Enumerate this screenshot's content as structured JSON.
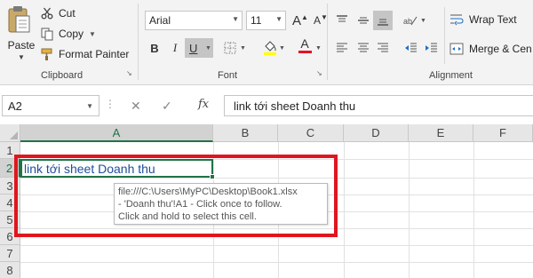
{
  "clipboard": {
    "paste_label": "Paste",
    "cut_label": "Cut",
    "copy_label": "Copy",
    "format_painter_label": "Format Painter",
    "group_label": "Clipboard"
  },
  "font": {
    "name": "Arial",
    "size": "11",
    "group_label": "Font",
    "bold_label": "B",
    "italic_label": "I",
    "underline_label": "U",
    "font_color_label": "A",
    "grow_label": "A",
    "shrink_label": "A",
    "font_color_bar": "#e81123",
    "fill_color_bar": "#ffff00"
  },
  "alignment": {
    "wrap_text_label": "Wrap Text",
    "merge_label": "Merge & Cen",
    "group_label": "Alignment"
  },
  "formula_bar": {
    "name_box": "A2",
    "cancel_label": "✕",
    "enter_label": "✓",
    "fx_label": "fx",
    "content": "link tới sheet Doanh thu"
  },
  "grid": {
    "columns": [
      "A",
      "B",
      "C",
      "D",
      "E",
      "F"
    ],
    "rows": [
      "1",
      "2",
      "3",
      "4",
      "5",
      "6",
      "7",
      "8"
    ],
    "selected_column": "A",
    "selected_row": "2",
    "cell_a2": "link tới sheet Doanh thu"
  },
  "tooltip": {
    "line1": "file:///C:\\Users\\MyPC\\Desktop\\Book1.xlsx",
    "line2": "- 'Doanh thu'!A1 - Click once to follow.",
    "line3": "Click and hold to select this cell."
  },
  "colors": {
    "accent_green": "#217346",
    "hyperlink_blue": "#1f4e99",
    "highlight_red": "#e0161e"
  }
}
